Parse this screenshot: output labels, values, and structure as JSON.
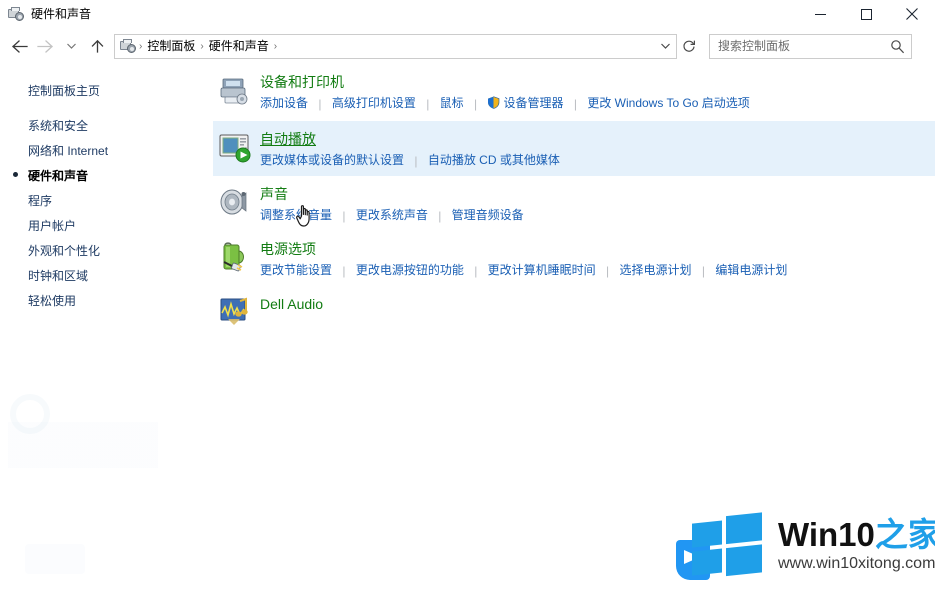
{
  "window": {
    "title": "硬件和声音",
    "icon": "hardware-sound-icon",
    "buttons": {
      "minimize": "最小化",
      "maximize": "最大化",
      "close": "关闭"
    }
  },
  "nav": {
    "back": "后退",
    "forward": "前进",
    "recent": "最近浏览的位置",
    "up": "上移一级",
    "refresh": "刷新",
    "breadcrumb": {
      "icon": "control-panel-icon",
      "items": [
        "控制面板",
        "硬件和声音"
      ],
      "separator": "›"
    },
    "dropdown_icon": "chevron-down-icon"
  },
  "search": {
    "placeholder": "搜索控制面板",
    "value": "",
    "icon": "search-icon"
  },
  "sidebar": {
    "home": "控制面板主页",
    "items": [
      {
        "label": "系统和安全",
        "current": false
      },
      {
        "label": "网络和 Internet",
        "current": false
      },
      {
        "label": "硬件和声音",
        "current": true
      },
      {
        "label": "程序",
        "current": false
      },
      {
        "label": "用户帐户",
        "current": false
      },
      {
        "label": "外观和个性化",
        "current": false
      },
      {
        "label": "时钟和区域",
        "current": false
      },
      {
        "label": "轻松使用",
        "current": false
      }
    ]
  },
  "main": {
    "sections": [
      {
        "title": "设备和打印机",
        "icon": "devices-printers-icon",
        "highlighted": false,
        "hovered": false,
        "links": [
          {
            "label": "添加设备",
            "shield": false
          },
          {
            "label": "高级打印机设置",
            "shield": false
          },
          {
            "label": "鼠标",
            "shield": false
          },
          {
            "label": "设备管理器",
            "shield": true
          },
          {
            "label": "更改 Windows To Go 启动选项",
            "shield": false
          }
        ]
      },
      {
        "title": "自动播放",
        "icon": "autoplay-icon",
        "highlighted": true,
        "hovered": true,
        "links": [
          {
            "label": "更改媒体或设备的默认设置",
            "shield": false
          },
          {
            "label": "自动播放 CD 或其他媒体",
            "shield": false
          }
        ]
      },
      {
        "title": "声音",
        "icon": "sound-icon",
        "highlighted": false,
        "hovered": false,
        "links": [
          {
            "label": "调整系统音量",
            "shield": false
          },
          {
            "label": "更改系统声音",
            "shield": false
          },
          {
            "label": "管理音频设备",
            "shield": false
          }
        ]
      },
      {
        "title": "电源选项",
        "icon": "power-options-icon",
        "highlighted": false,
        "hovered": false,
        "links": [
          {
            "label": "更改节能设置",
            "shield": false
          },
          {
            "label": "更改电源按钮的功能",
            "shield": false
          },
          {
            "label": "更改计算机睡眠时间",
            "shield": false
          },
          {
            "label": "选择电源计划",
            "shield": false
          },
          {
            "label": "编辑电源计划",
            "shield": false
          }
        ]
      },
      {
        "title": "Dell Audio",
        "icon": "dell-audio-icon",
        "highlighted": false,
        "hovered": false,
        "links": []
      }
    ]
  },
  "cursor": {
    "type": "hand-pointer-cursor"
  },
  "watermark": {
    "brand_dark": "Win10",
    "brand_blue": "之家",
    "url": "www.win10xitong.com",
    "logo": "windows-logo"
  },
  "colors": {
    "heading_green": "#127c12",
    "link_blue": "#1a5fb4",
    "sidebar_blue": "#1f3b63",
    "highlight_bg": "#e5f1fb",
    "watermark_blue": "#1f9fe8"
  }
}
